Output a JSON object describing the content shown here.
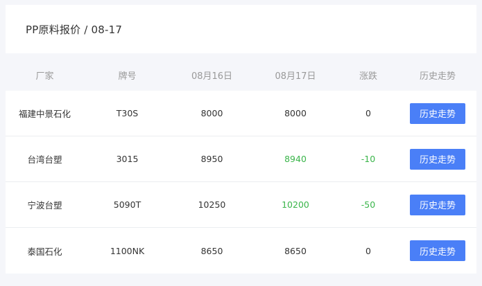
{
  "header": {
    "title": "PP原料报价 / 08-17"
  },
  "table": {
    "columns": [
      "厂家",
      "牌号",
      "08月16日",
      "08月17日",
      "涨跌",
      "历史走势"
    ],
    "rows": [
      {
        "maker": "福建中景石化",
        "grade": "T30S",
        "prev": "8000",
        "curr": "8000",
        "change": "0",
        "trend": "flat",
        "button": "历史走势"
      },
      {
        "maker": "台湾台塑",
        "grade": "3015",
        "prev": "8950",
        "curr": "8940",
        "change": "-10",
        "trend": "down",
        "button": "历史走势"
      },
      {
        "maker": "宁波台塑",
        "grade": "5090T",
        "prev": "10250",
        "curr": "10200",
        "change": "-50",
        "trend": "down",
        "button": "历史走势"
      },
      {
        "maker": "泰国石化",
        "grade": "1100NK",
        "prev": "8650",
        "curr": "8650",
        "change": "0",
        "trend": "flat",
        "button": "历史走势"
      }
    ]
  },
  "colors": {
    "accent": "#4a7ff7",
    "down": "#3ab54a",
    "text": "#333333",
    "muted": "#999999"
  }
}
